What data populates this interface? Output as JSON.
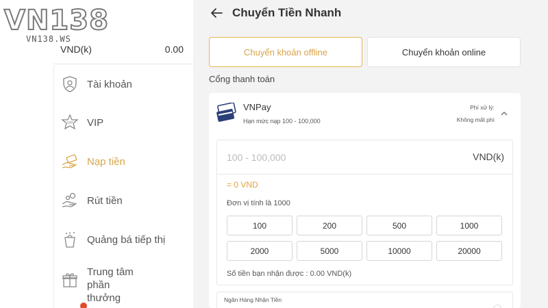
{
  "brand": {
    "logo": "VN138",
    "domain": "VN138.WS"
  },
  "balance": {
    "label": "VND(k)",
    "value": "0.00"
  },
  "sidebar": {
    "items": [
      {
        "label": "Tài khoản",
        "icon": "account-shield-icon"
      },
      {
        "label": "VIP",
        "icon": "vip-star-icon"
      },
      {
        "label": "Nạp tiền",
        "icon": "deposit-hand-icon",
        "active": true
      },
      {
        "label": "Rút tiền",
        "icon": "withdraw-hand-icon"
      },
      {
        "label": "Quảng bá tiếp thị",
        "icon": "promotion-bag-icon"
      },
      {
        "label": "Trung tâm phần thưởng",
        "icon": "gift-icon"
      }
    ]
  },
  "header": {
    "title": "Chuyển Tiền Nhanh"
  },
  "tabs": {
    "offline": "Chuyển khoản offline",
    "online": "Chuyển khoản online"
  },
  "gateway": {
    "label": "Cổng thanh toán",
    "name": "VNPay",
    "limit": "Hạn mức nạp 100 - 100,000",
    "fee_label": "Phí xử lý:",
    "fee_value": "Không mất phí"
  },
  "form": {
    "placeholder": "100 - 100,000",
    "currency": "VND(k)",
    "converted": "= 0 VND",
    "unit_note": "Đơn vị tính là 1000",
    "amounts": [
      "100",
      "200",
      "500",
      "1000",
      "2000",
      "5000",
      "10000",
      "20000"
    ],
    "received": "Số tiền bạn nhận được : 0.00 VND(k)"
  },
  "bank": {
    "label": "Ngân Hàng Nhận Tiền"
  },
  "colors": {
    "accent": "#d9a44a",
    "accent_border": "#e8b84f",
    "converted": "#e4a33a"
  }
}
